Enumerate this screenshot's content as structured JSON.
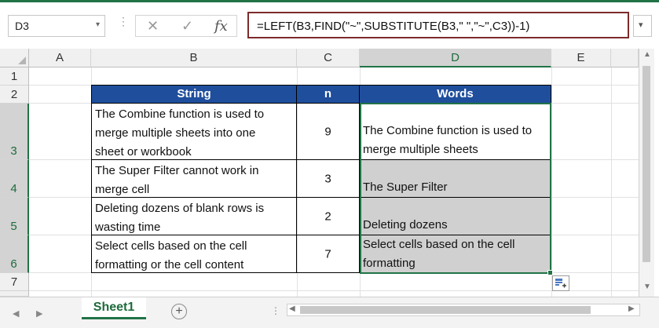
{
  "name_box": {
    "value": "D3"
  },
  "formula_bar": {
    "cancel_icon": "✕",
    "enter_icon": "✓",
    "fx_label": "fx",
    "formula": "=LEFT(B3,FIND(\"~\",SUBSTITUTE(B3,\" \",\"~\",C3))-1)"
  },
  "columns": [
    "A",
    "B",
    "C",
    "D",
    "E"
  ],
  "rows": [
    "1",
    "2",
    "3",
    "4",
    "5",
    "6",
    "7"
  ],
  "table": {
    "headers": [
      "String",
      "n",
      "Words"
    ],
    "rows": [
      {
        "string_lines": [
          "The Combine function is used to",
          "merge multiple sheets into one",
          "sheet or workbook"
        ],
        "n": "9",
        "words_lines": [
          "The Combine function is used to",
          "merge multiple sheets"
        ]
      },
      {
        "string_lines": [
          "The Super Filter cannot work in",
          "merge cell"
        ],
        "n": "3",
        "words_lines": [
          "The Super Filter"
        ]
      },
      {
        "string_lines": [
          "Deleting dozens of blank rows is",
          "wasting time"
        ],
        "n": "2",
        "words_lines": [
          "Deleting dozens"
        ]
      },
      {
        "string_lines": [
          "Select cells based on the cell",
          "formatting or the cell content"
        ],
        "n": "7",
        "words_lines": [
          "Select cells based on the cell",
          "formatting"
        ]
      }
    ]
  },
  "sheet_tabs": {
    "active": "Sheet1",
    "add_icon": "+"
  },
  "colors": {
    "accent": "#217346",
    "header_fill": "#1f4e9c",
    "gray_fill": "#d0d0d0",
    "formula_border": "#7d2b2b"
  }
}
